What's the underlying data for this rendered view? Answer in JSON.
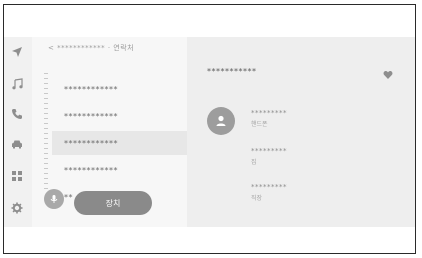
{
  "list": {
    "breadcrumb": "< ************ · 연락처",
    "rows": [
      "************",
      "************",
      "************",
      "************",
      "**"
    ]
  },
  "buttons": {
    "device_label": "장치"
  },
  "detail": {
    "name": "***********",
    "entries": [
      {
        "number": "*********",
        "label": "핸드폰"
      },
      {
        "number": "*********",
        "label": "집"
      },
      {
        "number": "*********",
        "label": "직장"
      }
    ]
  },
  "icons": {
    "nav": [
      "navigation-arrow-icon",
      "music-note-icon",
      "phone-icon",
      "car-icon",
      "apps-grid-icon",
      "gear-icon"
    ],
    "favorite": "heart-icon",
    "avatar": "person-icon",
    "voice": "microphone-icon"
  },
  "colors": {
    "screen_bg": "#f1f1f1",
    "selected_row": "#e7e7e7",
    "button": "#8a8a8a",
    "icon": "#8e8e8e"
  }
}
